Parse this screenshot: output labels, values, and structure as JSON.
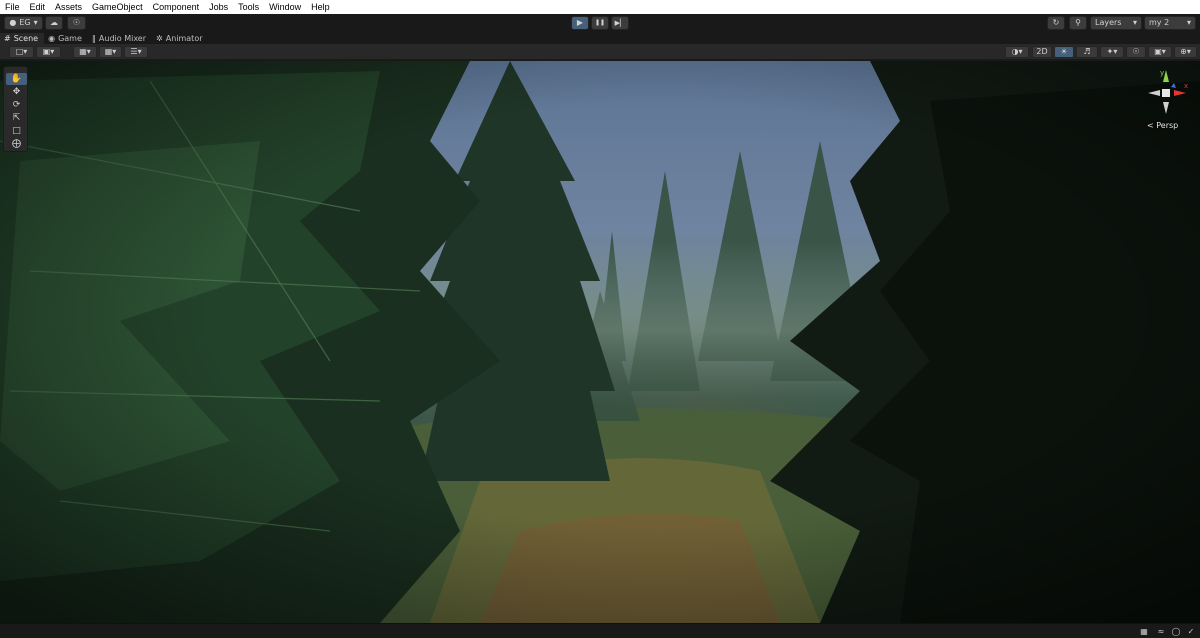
{
  "menu": [
    "File",
    "Edit",
    "Assets",
    "GameObject",
    "Component",
    "Jobs",
    "Tools",
    "Window",
    "Help"
  ],
  "toolbar": {
    "account_label": "EG",
    "play_icon": "▶",
    "pause_icon": "❚❚",
    "step_icon": "▶▏",
    "layers_label": "Layers",
    "layout_label": "my 2"
  },
  "tabs": [
    {
      "label": "Scene",
      "icon": "#",
      "active": true
    },
    {
      "label": "Game",
      "icon": "◉",
      "active": false
    },
    {
      "label": "Audio Mixer",
      "icon": "‖",
      "active": false
    },
    {
      "label": "Animator",
      "icon": "✲",
      "active": false
    }
  ],
  "scene_bar": {
    "toggle_2d_label": "2D"
  },
  "scene_view": {
    "projection_label": "Persp",
    "gizmo_axes": {
      "y": "y",
      "x": "x"
    }
  },
  "colors": {
    "accent": "#46607c",
    "gizmo_y": "#8fd14a",
    "gizmo_x": "#e0392b",
    "gizmo_z": "#3c6fd8"
  }
}
